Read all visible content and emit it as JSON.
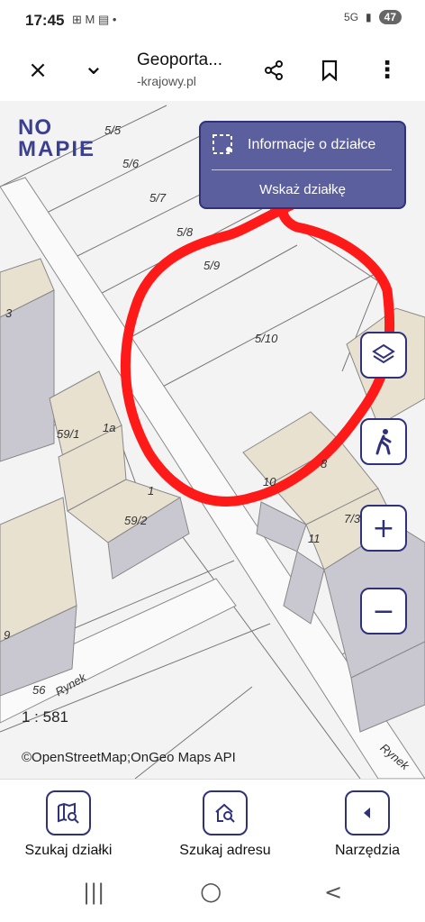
{
  "status": {
    "time": "17:45",
    "left_icons": "⊞ M ▤ •",
    "network": "5G",
    "signal": "▮",
    "battery": "47"
  },
  "browser": {
    "title": "Geoporta...",
    "url": "-krajowy.pl",
    "close_icon": "×",
    "chevron_icon": "⌄",
    "share_icon": "share",
    "bookmark_icon": "bookmark",
    "menu_icon": "⋮"
  },
  "map": {
    "logo_line1": "NO",
    "logo_line2": "MAPIE",
    "panel": {
      "title": "Informacje o działce",
      "choose": "Wskaż działkę"
    },
    "parcel_labels": [
      "5/5",
      "5/6",
      "5/7",
      "5/8",
      "5/9",
      "5/10",
      "59/1",
      "1a",
      "1",
      "59/2",
      "3",
      "10",
      "8",
      "7/3",
      "11",
      "9",
      "56"
    ],
    "street_labels": [
      "Rynek",
      "Rynek"
    ],
    "scale": "1 : 581",
    "attribution": "©OpenStreetMap;OnGeo Maps API",
    "buttons": {
      "layers": "◈",
      "walk": "🚶",
      "zoom_in": "+",
      "zoom_out": "−"
    }
  },
  "nav": {
    "search_parcel": "Szukaj działki",
    "search_address": "Szukaj adresu",
    "tools": "Narzędzia"
  },
  "sysnav": {
    "recents": "|||",
    "home": "○",
    "back": "<"
  },
  "colors": {
    "accent": "#2f327a",
    "panel": "#5b5f9e",
    "annotation": "#ff1a1a"
  }
}
